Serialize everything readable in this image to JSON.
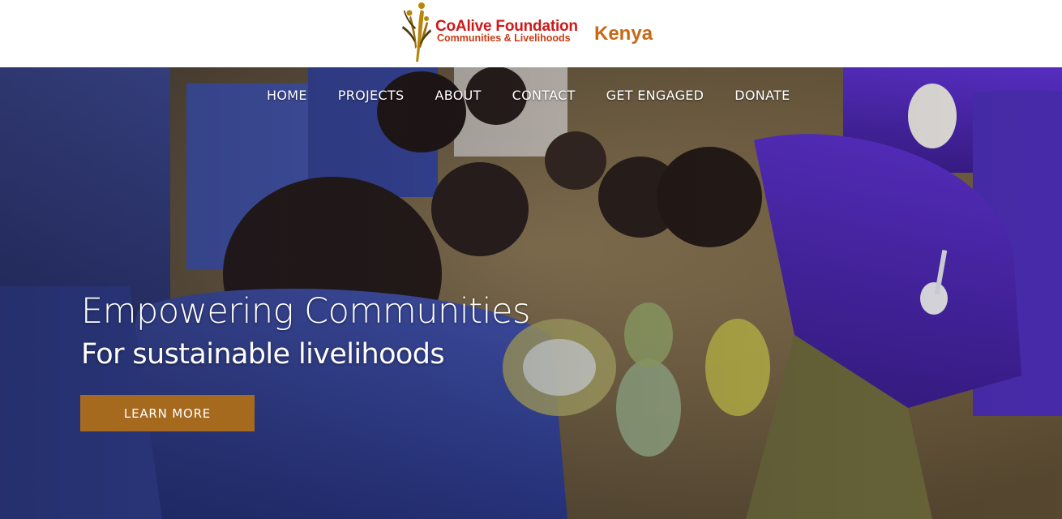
{
  "brand": {
    "name": "CoAlive Foundation",
    "tagline": "Communities & Livelihoods",
    "country": "Kenya",
    "colors": {
      "name": "#d01818",
      "tagline": "#c93b12",
      "country": "#c66a14",
      "mark": "#b8860b"
    }
  },
  "nav": {
    "items": [
      {
        "label": "HOME"
      },
      {
        "label": "PROJECTS"
      },
      {
        "label": "ABOUT"
      },
      {
        "label": "CONTACT"
      },
      {
        "label": "GET ENGAGED"
      },
      {
        "label": "DONATE"
      }
    ]
  },
  "hero": {
    "headline": "Empowering Communities",
    "subheadline": "For sustainable livelihoods",
    "cta_label": "LEARN MORE",
    "cta_color": "#a56a1e"
  }
}
